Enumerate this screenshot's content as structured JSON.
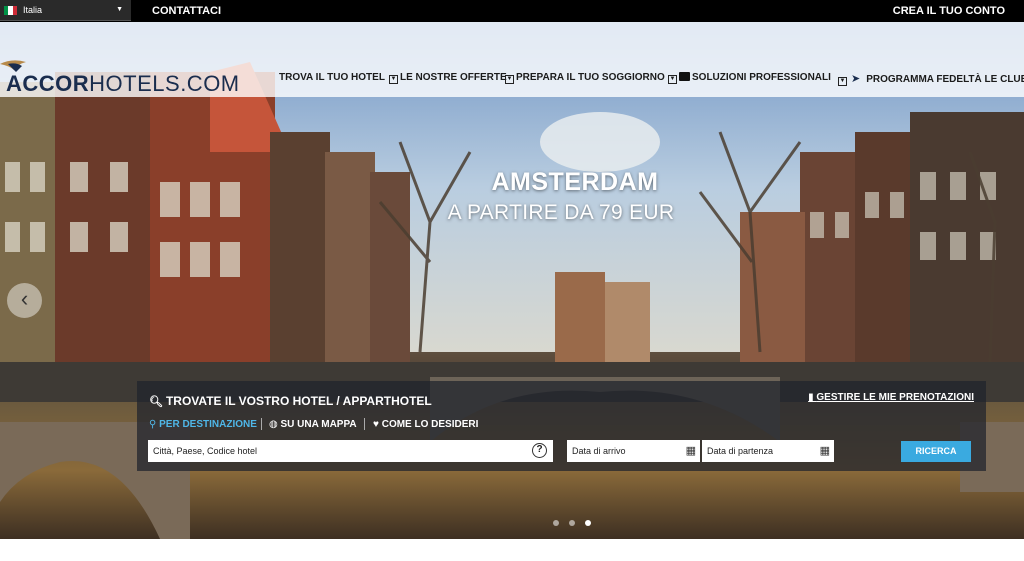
{
  "topbar": {
    "language": "Italia",
    "contact": "CONTATTACI",
    "account": "CREA IL TUO CONTO"
  },
  "header": {
    "logo_bold": "ACCOR",
    "logo_rest": "HOTELS.COM",
    "nav": [
      "TROVA IL TUO HOTEL",
      "LE NOSTRE OFFERTE",
      "PREPARA IL TUO SOGGIORNO",
      "SOLUZIONI PROFESSIONALI",
      "PROGRAMMA FEDELTÀ LE CLUB"
    ]
  },
  "hero": {
    "city": "AMSTERDAM",
    "price": "A PARTIRE DA 79 EUR",
    "slides": 3,
    "active_slide": 3
  },
  "search": {
    "title": "TROVATE IL VOSTRO HOTEL / APPARTHOTEL",
    "manage": "GESTIRE LE MIE PRENOTAZIONI",
    "modes": [
      "PER DESTINAZIONE",
      "SU UNA MAPPA",
      "COME LO DESIDERI"
    ],
    "destination_placeholder": "Città, Paese, Codice hotel",
    "arrival_placeholder": "Data di arrivo",
    "departure_placeholder": "Data di partenza",
    "button": "RICERCA"
  },
  "colors": {
    "accent": "#3aaae0",
    "brand_navy": "#1a2d4e"
  }
}
